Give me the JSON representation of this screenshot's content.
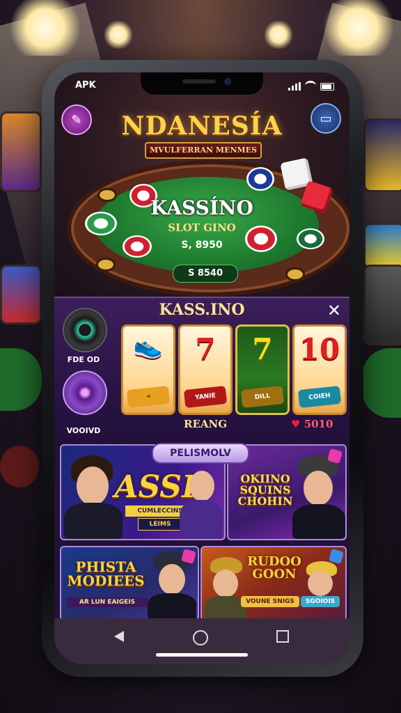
{
  "status_bar": {
    "carrier": "APK"
  },
  "header": {
    "title": "NDANESÍA",
    "subtitle": "MVULFERRAN MENMES",
    "left_button_icon": "edit-icon",
    "right_button_icon": "cast-icon"
  },
  "table": {
    "title": "KASSÍNO",
    "subtitle": "SLOT GINO",
    "amount": "S, 8950",
    "balance": "S 8540"
  },
  "slot_panel": {
    "title": "KASS.INO",
    "close_icon": "close-icon",
    "left_dials": [
      {
        "label": "FDE OD"
      },
      {
        "label": "VOOIVD"
      }
    ],
    "reels": [
      {
        "symbol": "",
        "badge": ""
      },
      {
        "symbol": "7",
        "badge": "YANIE"
      },
      {
        "symbol": "7",
        "badge": "DILL"
      },
      {
        "symbol": "10",
        "badge": "COIEH"
      }
    ],
    "footer_left": "REANG",
    "footer_right": "5010"
  },
  "promos": {
    "header": "PELISMOLV",
    "cards": [
      {
        "big": "ASSI",
        "small": "CUMLECCINS",
        "tag": "LEIMS"
      },
      {
        "big": "OKIINO\nSQUINS\nCHOHIN"
      },
      {
        "big": "PHISTA\nMODIEES",
        "small": "AR LUN EAIGEIS"
      },
      {
        "big": "RUDOO\nGOON",
        "small": "VOUNE SNIGS",
        "tag": "SGOIOIS"
      }
    ]
  },
  "navbar": {
    "back_icon": "back-triangle-icon",
    "home_icon": "home-circle-icon",
    "recents_icon": "recents-square-icon"
  },
  "colors": {
    "gold": "#ffd24a",
    "felt_green": "#1e7a2e",
    "purple_panel": "#2a1446",
    "red_accent": "#e02020"
  }
}
